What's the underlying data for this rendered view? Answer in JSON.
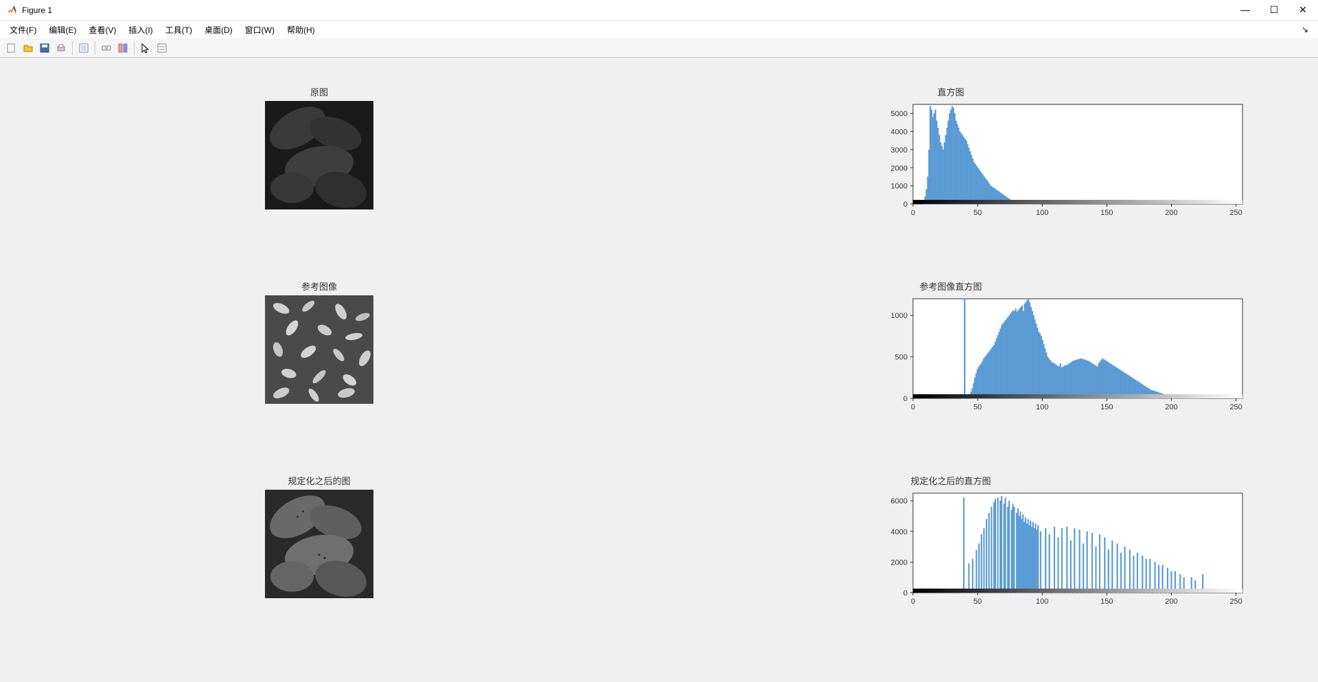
{
  "window": {
    "title": "Figure 1"
  },
  "menu": {
    "file": "文件(F)",
    "edit": "编辑(E)",
    "view": "查看(V)",
    "insert": "插入(I)",
    "tools": "工具(T)",
    "desktop": "桌面(D)",
    "window": "窗口(W)",
    "help": "帮助(H)"
  },
  "subplots": {
    "img1_title": "原图",
    "hist1_title": "直方图",
    "img2_title": "参考图像",
    "hist2_title": "参考图像直方图",
    "img3_title": "规定化之后的图",
    "hist3_title": "规定化之后的直方图"
  },
  "chart_data": [
    {
      "type": "bar",
      "title": "直方图",
      "xlabel": "",
      "ylabel": "",
      "xlim": [
        0,
        255
      ],
      "ylim": [
        0,
        5500
      ],
      "xticks": [
        0,
        50,
        100,
        150,
        200,
        250
      ],
      "yticks": [
        0,
        1000,
        2000,
        3000,
        4000,
        5000
      ],
      "values": [
        0,
        0,
        0,
        0,
        0,
        0,
        0,
        0,
        200,
        400,
        800,
        1500,
        3000,
        5400,
        5200,
        4800,
        5000,
        5200,
        4600,
        4200,
        3800,
        3400,
        3200,
        3000,
        3400,
        3800,
        4200,
        4600,
        5000,
        5200,
        5400,
        5300,
        5000,
        4600,
        4400,
        4200,
        4000,
        3900,
        3800,
        3700,
        3600,
        3500,
        3300,
        3100,
        2900,
        2700,
        2500,
        2300,
        2200,
        2100,
        2000,
        1900,
        1800,
        1700,
        1600,
        1500,
        1400,
        1300,
        1200,
        1100,
        1000,
        950,
        900,
        850,
        800,
        750,
        700,
        650,
        600,
        550,
        500,
        450,
        400,
        350,
        300,
        250,
        200,
        150,
        120,
        100,
        80,
        60,
        50,
        40,
        30,
        25,
        20,
        15,
        10,
        8,
        6,
        5,
        4,
        3,
        2,
        2,
        1,
        1,
        1,
        0,
        0,
        0,
        0,
        0,
        0,
        0,
        0,
        0,
        0,
        0,
        0,
        0,
        0,
        0,
        0,
        0,
        0,
        0,
        0,
        0,
        0,
        0,
        0,
        0,
        0,
        0,
        0,
        0,
        0,
        0,
        0,
        0,
        0,
        0,
        0,
        0,
        0,
        0,
        0,
        0,
        0,
        0,
        0,
        0,
        0,
        0,
        0,
        0,
        0,
        0,
        0,
        0,
        0,
        0,
        0,
        0,
        0,
        0,
        0,
        0,
        0,
        0,
        0,
        0,
        0,
        0,
        0,
        0,
        0,
        0,
        0,
        0,
        0,
        0,
        0,
        0,
        0,
        0,
        0,
        0,
        0,
        0,
        0,
        0,
        0,
        0,
        0,
        0,
        0,
        0,
        0,
        0,
        0,
        0,
        0,
        0,
        0,
        0,
        0,
        0,
        0,
        0,
        0,
        0,
        0,
        0,
        0,
        0,
        0,
        0,
        0,
        0,
        0,
        0,
        0,
        0,
        0,
        0,
        0,
        0,
        0,
        0,
        0,
        0,
        0,
        0,
        0,
        0,
        0,
        0,
        0,
        0,
        0,
        0,
        0,
        0,
        0,
        0,
        0,
        0,
        0,
        0,
        0,
        0,
        0,
        0,
        0,
        0,
        0,
        0,
        0,
        0,
        0,
        0,
        0,
        0
      ]
    },
    {
      "type": "bar",
      "title": "参考图像直方图",
      "xlabel": "",
      "ylabel": "",
      "xlim": [
        0,
        255
      ],
      "ylim": [
        0,
        1200
      ],
      "xticks": [
        0,
        50,
        100,
        150,
        200,
        250
      ],
      "yticks": [
        0,
        500,
        1000
      ],
      "values": [
        0,
        0,
        0,
        0,
        0,
        0,
        0,
        0,
        0,
        0,
        0,
        0,
        0,
        0,
        0,
        0,
        0,
        0,
        0,
        0,
        0,
        0,
        0,
        0,
        0,
        0,
        0,
        0,
        0,
        0,
        0,
        0,
        0,
        0,
        0,
        0,
        0,
        0,
        0,
        0,
        1200,
        5,
        0,
        0,
        50,
        80,
        120,
        180,
        250,
        300,
        350,
        380,
        400,
        420,
        450,
        480,
        500,
        520,
        540,
        560,
        580,
        600,
        620,
        640,
        680,
        720,
        760,
        800,
        840,
        880,
        900,
        920,
        940,
        960,
        980,
        1000,
        1020,
        1040,
        1060,
        1050,
        1080,
        1040,
        1060,
        1080,
        1100,
        1120,
        1050,
        1140,
        1160,
        1180,
        1200,
        1150,
        1100,
        1050,
        1000,
        950,
        900,
        850,
        800,
        780,
        750,
        700,
        650,
        600,
        550,
        500,
        480,
        460,
        440,
        430,
        420,
        410,
        400,
        390,
        380,
        420,
        370,
        380,
        390,
        395,
        400,
        410,
        420,
        430,
        440,
        450,
        455,
        460,
        465,
        470,
        475,
        480,
        475,
        470,
        465,
        460,
        455,
        450,
        440,
        430,
        420,
        410,
        400,
        390,
        380,
        420,
        440,
        460,
        480,
        470,
        460,
        450,
        440,
        430,
        420,
        410,
        400,
        390,
        380,
        370,
        360,
        350,
        340,
        330,
        320,
        310,
        300,
        290,
        280,
        270,
        260,
        250,
        240,
        230,
        220,
        210,
        200,
        190,
        180,
        170,
        160,
        150,
        140,
        130,
        120,
        110,
        100,
        95,
        90,
        85,
        80,
        75,
        70,
        65,
        60,
        55,
        50,
        48,
        46,
        44,
        42,
        40,
        38,
        36,
        34,
        32,
        30,
        28,
        26,
        24,
        22,
        20,
        18,
        16,
        14,
        12,
        10,
        9,
        8,
        7,
        6,
        5,
        4,
        3,
        2,
        1,
        0,
        0,
        0,
        0,
        0,
        0,
        0,
        0,
        0,
        0,
        0,
        0,
        0,
        0,
        0,
        0,
        0,
        0,
        0,
        0,
        0,
        0,
        0,
        0,
        0,
        0,
        0,
        0,
        0,
        0,
        0,
        0
      ]
    },
    {
      "type": "bar",
      "title": "规定化之后的直方图",
      "xlabel": "",
      "ylabel": "",
      "xlim": [
        0,
        255
      ],
      "ylim": [
        0,
        6500
      ],
      "xticks": [
        0,
        50,
        100,
        150,
        200,
        250
      ],
      "yticks": [
        0,
        2000,
        4000,
        6000
      ],
      "values": [
        0,
        0,
        0,
        0,
        0,
        0,
        0,
        0,
        0,
        0,
        0,
        0,
        0,
        0,
        0,
        0,
        0,
        0,
        0,
        0,
        0,
        0,
        0,
        0,
        0,
        0,
        0,
        0,
        0,
        0,
        0,
        0,
        0,
        0,
        0,
        0,
        0,
        0,
        0,
        0,
        6200,
        0,
        0,
        0,
        1900,
        0,
        0,
        2200,
        0,
        0,
        2800,
        0,
        3200,
        0,
        3800,
        0,
        4200,
        0,
        4800,
        0,
        5200,
        0,
        5600,
        0,
        5900,
        6100,
        0,
        6200,
        0,
        6000,
        6300,
        0,
        5800,
        6200,
        0,
        5600,
        6000,
        0,
        5400,
        5800,
        5600,
        0,
        5200,
        5500,
        5000,
        5300,
        4800,
        5100,
        4600,
        4900,
        4500,
        4800,
        4400,
        4700,
        4300,
        4600,
        4200,
        4500,
        4100,
        4400,
        0,
        4000,
        0,
        0,
        0,
        4200,
        0,
        0,
        3800,
        0,
        0,
        0,
        4300,
        0,
        0,
        3600,
        0,
        0,
        4200,
        0,
        0,
        0,
        4300,
        0,
        0,
        3400,
        0,
        0,
        4200,
        0,
        0,
        0,
        4100,
        0,
        0,
        3200,
        0,
        0,
        4000,
        0,
        0,
        0,
        3900,
        0,
        0,
        3000,
        0,
        0,
        3800,
        0,
        0,
        0,
        3600,
        0,
        0,
        2800,
        0,
        0,
        3400,
        0,
        0,
        0,
        3200,
        0,
        0,
        2600,
        0,
        0,
        3000,
        0,
        0,
        0,
        2800,
        0,
        0,
        2400,
        0,
        0,
        2600,
        0,
        0,
        0,
        2400,
        0,
        0,
        2200,
        0,
        0,
        2200,
        0,
        0,
        0,
        2000,
        0,
        0,
        1800,
        0,
        0,
        1800,
        0,
        0,
        0,
        1600,
        0,
        0,
        1400,
        0,
        0,
        1400,
        0,
        0,
        0,
        1200,
        0,
        0,
        1000,
        0,
        0,
        0,
        0,
        0,
        1000,
        0,
        0,
        800,
        0,
        0,
        0,
        0,
        0,
        1200,
        0,
        0,
        0,
        0,
        0,
        0,
        0,
        0,
        0,
        0,
        0,
        0,
        0,
        0,
        0,
        0,
        0,
        0,
        0,
        0,
        0,
        0,
        0,
        0,
        0,
        0,
        0,
        0,
        0,
        0,
        0
      ]
    }
  ],
  "watermark": ""
}
